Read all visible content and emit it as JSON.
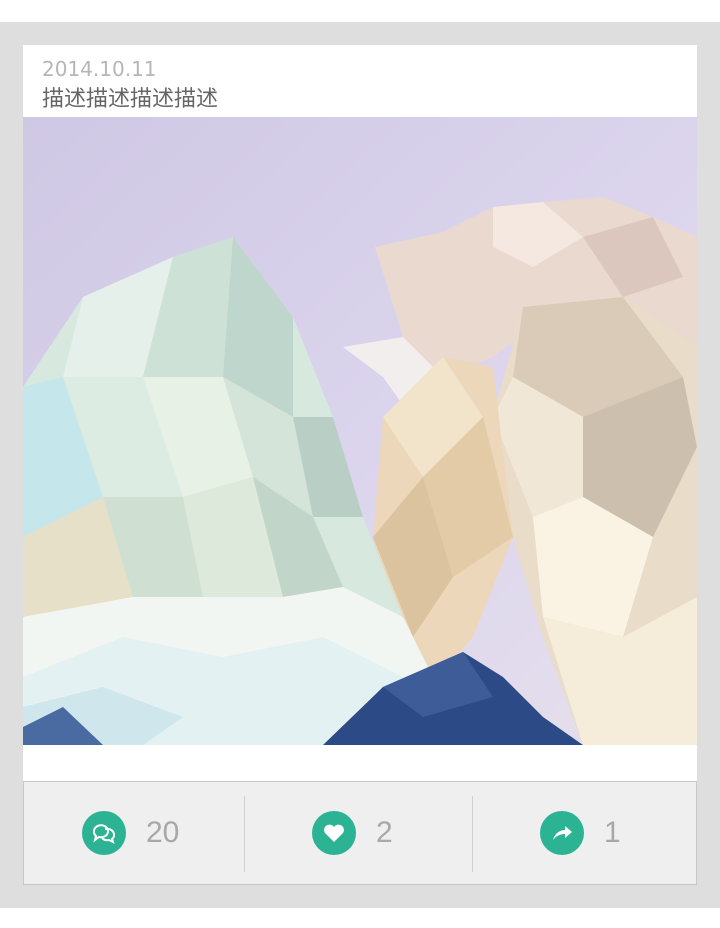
{
  "post": {
    "date": "2014.10.11",
    "description": "描述描述描述描述"
  },
  "image": {
    "subject": "low-poly-mountains"
  },
  "actions": {
    "comments": {
      "icon": "comment-bubbles-icon",
      "count": "20"
    },
    "likes": {
      "icon": "heart-icon",
      "count": "2"
    },
    "shares": {
      "icon": "share-arrow-icon",
      "count": "1"
    }
  },
  "colors": {
    "accent": "#2cb394",
    "frame": "#dedede",
    "action_bar": "#f0efef",
    "count_text": "#a8a8a8"
  }
}
